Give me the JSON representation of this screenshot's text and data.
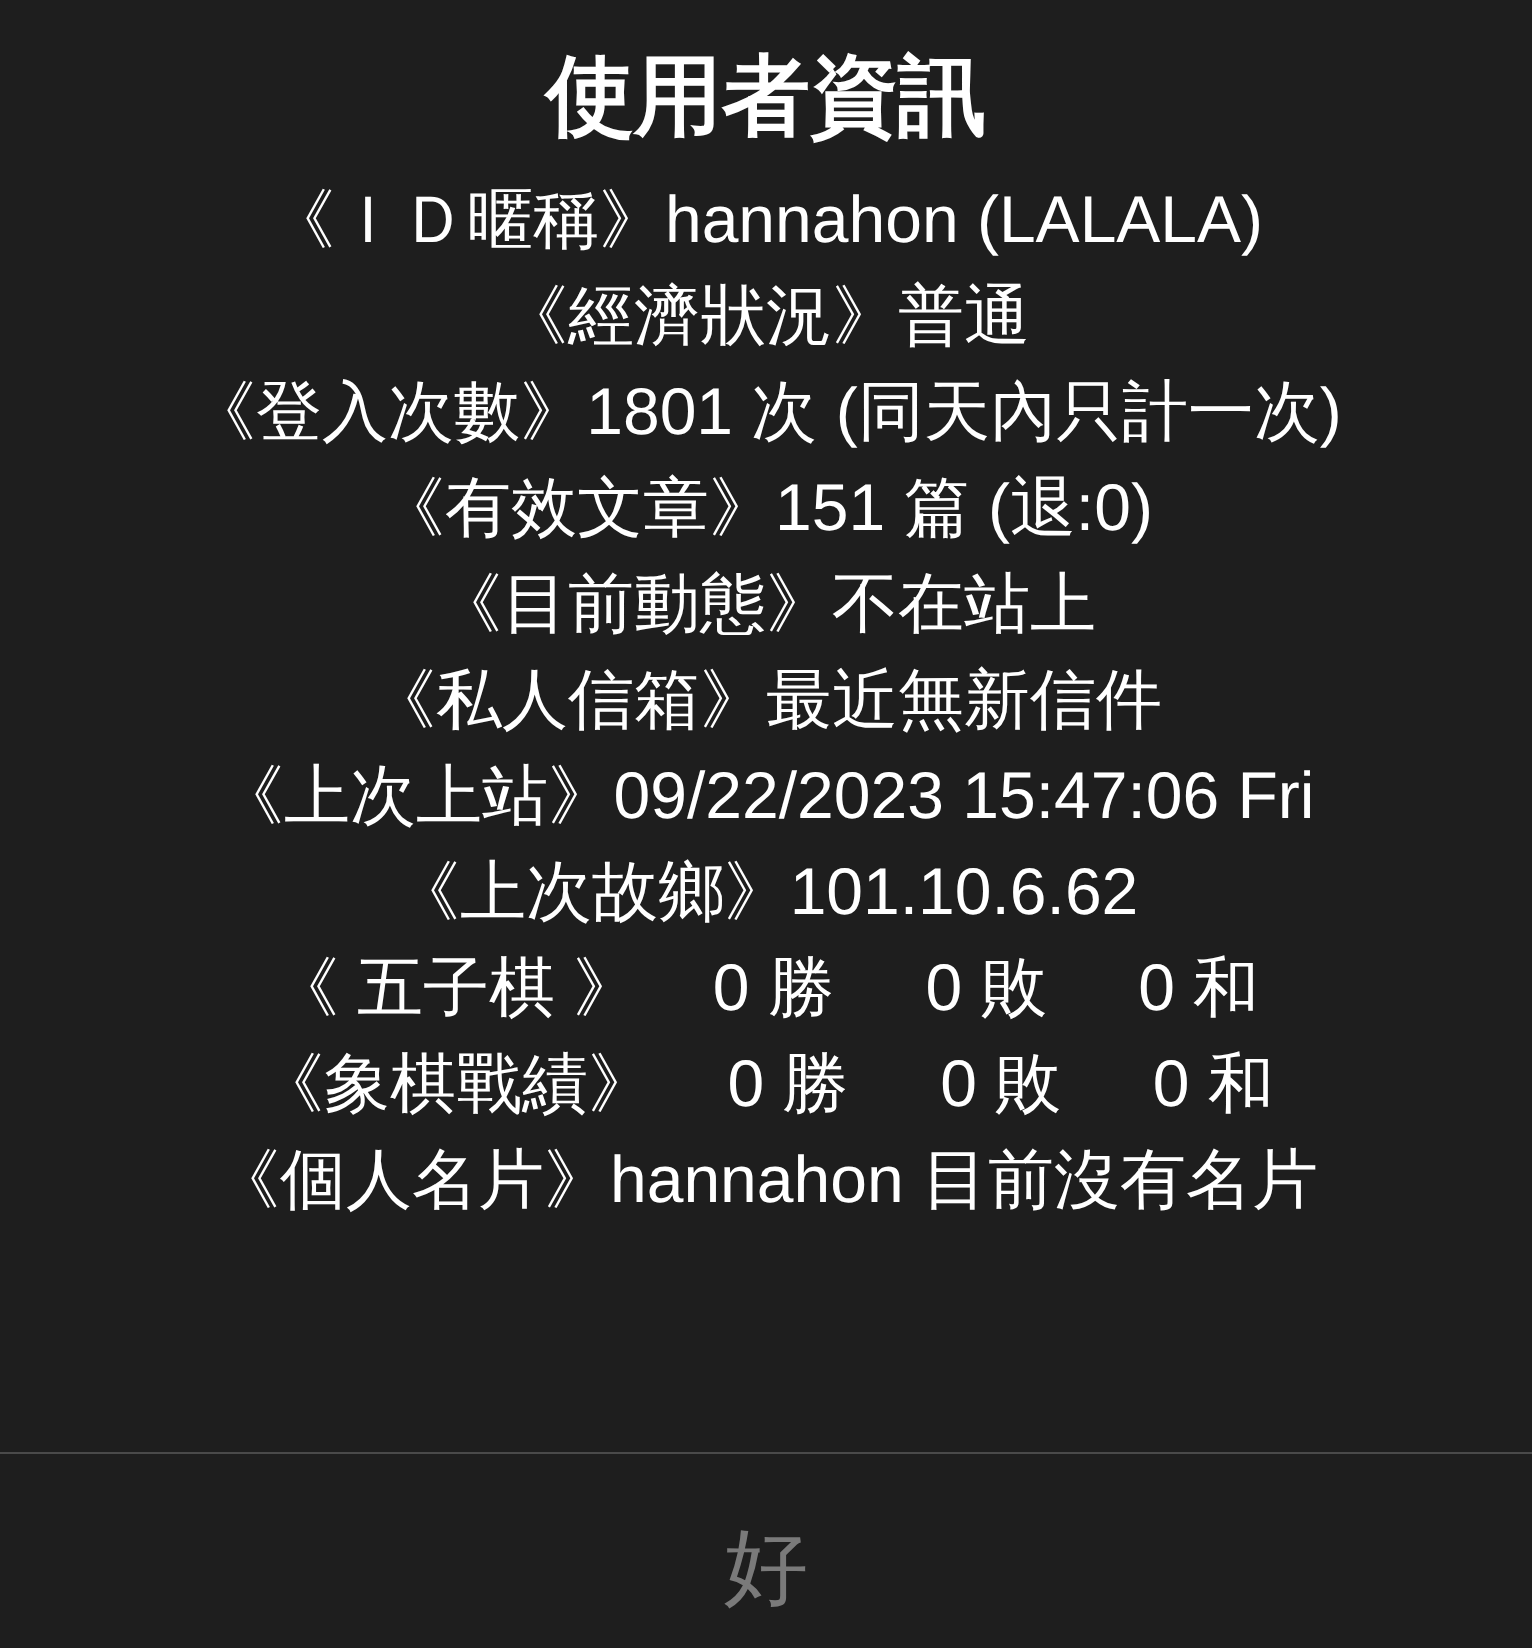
{
  "dialog": {
    "title": "使用者資訊",
    "lines": [
      "《ＩＤ暱稱》hannahon (LALALA)",
      "《經濟狀況》普通",
      "《登入次數》1801 次 (同天內只計一次)",
      "《有效文章》151 篇 (退:0)",
      "《目前動態》不在站上",
      "《私人信箱》最近無新信件",
      "《上次上站》09/22/2023 15:47:06 Fri",
      "《上次故鄉》101.10.6.62",
      "《 五子棋 》    0 勝     0 敗     0 和",
      "《象棋戰績》    0 勝     0 敗     0 和",
      "《個人名片》hannahon 目前沒有名片"
    ],
    "buttons": [
      {
        "label": "好",
        "disabled": true
      }
    ]
  }
}
